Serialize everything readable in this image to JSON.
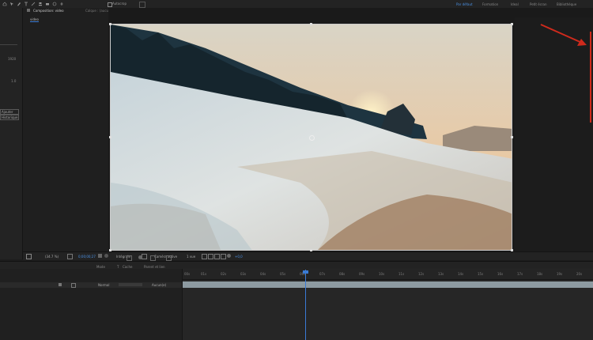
{
  "toolbar": {
    "autocrop_label": "Autocrop"
  },
  "workspaces": [
    "Par défaut",
    "Formation",
    "Ideal",
    "Petit écran",
    "Bibliothèque"
  ],
  "comp_panel": {
    "tab_label": "Composition: video",
    "secondary_label": "Calque : (aucun)",
    "subtab": "video"
  },
  "left_panel": {
    "values": [
      "1920",
      "1.0"
    ],
    "buttons": [
      "Ajouter",
      "Historique"
    ]
  },
  "viewer_bar": {
    "zoom": "(34.7 %)",
    "timecode": "0;00;00;27",
    "resolution": "Intégrale",
    "camera": "Caméra active",
    "views": "1 vue",
    "offset": "+0,0"
  },
  "timeline": {
    "columns": [
      "Mode",
      "T",
      "Cache",
      "Parent et lien"
    ],
    "layer_mode": "Normal",
    "layer_parent": "Aucun(e)",
    "ruler_ticks": [
      "00s",
      "01s",
      "02s",
      "03s",
      "04s",
      "05s",
      "06s",
      "07s",
      "08s",
      "09s",
      "10s",
      "11s",
      "12s",
      "13s",
      "14s",
      "15s",
      "16s",
      "17s",
      "18s",
      "19s",
      "20s"
    ]
  },
  "colors": {
    "accent_blue": "#3a7bd5",
    "annotation_red": "#cf2a1c"
  }
}
